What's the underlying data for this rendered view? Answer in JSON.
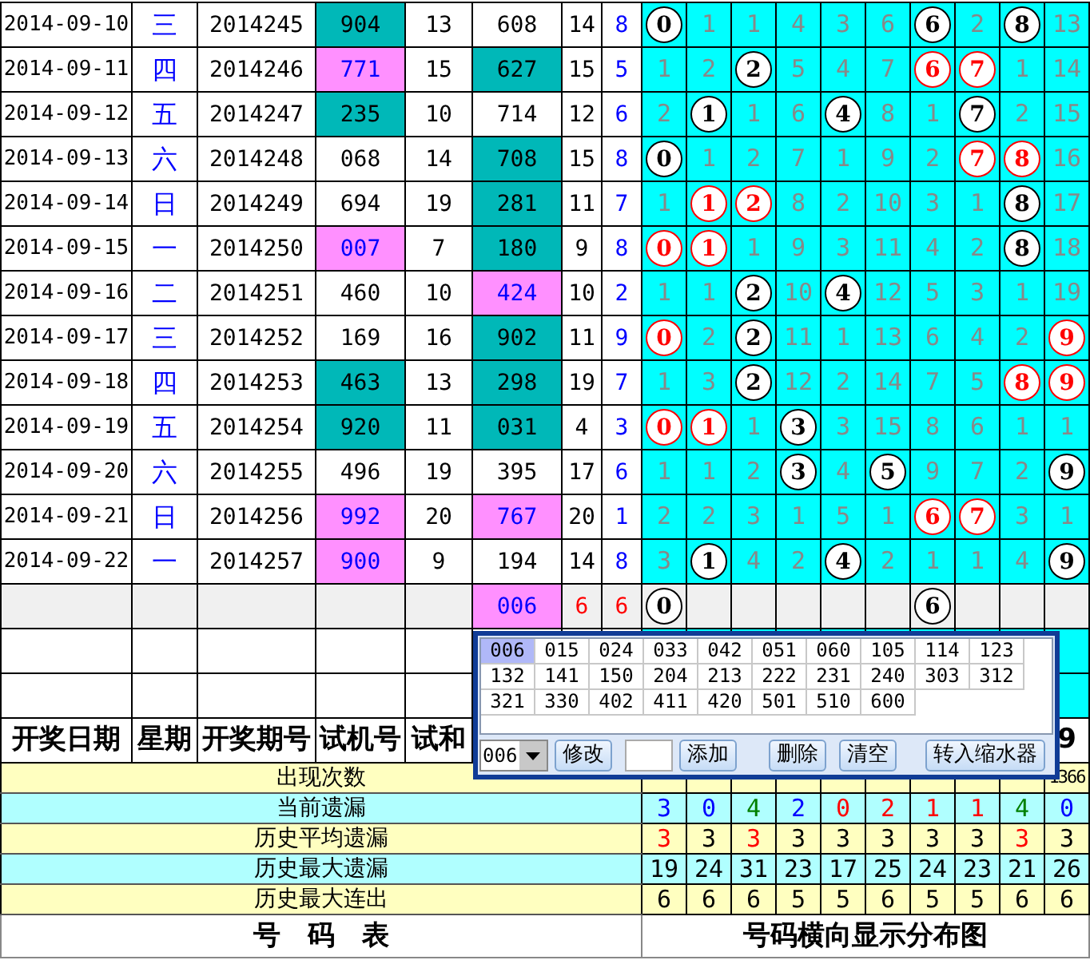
{
  "draw_rows": [
    {
      "date": "2014-09-10",
      "weekday": "三",
      "issue": "2014245",
      "trial": {
        "text": "904",
        "color": "#00b8b8"
      },
      "trial_sum": "13",
      "number": {
        "text": "608"
      },
      "sum": "14",
      "span": "8",
      "digits": [
        {
          "kind": "ball",
          "text": "0",
          "color": "#000000"
        },
        {
          "kind": "miss",
          "text": "1"
        },
        {
          "kind": "miss",
          "text": "1"
        },
        {
          "kind": "miss",
          "text": "4"
        },
        {
          "kind": "miss",
          "text": "3"
        },
        {
          "kind": "miss",
          "text": "6"
        },
        {
          "kind": "ball",
          "text": "6",
          "color": "#000000"
        },
        {
          "kind": "miss",
          "text": "2"
        },
        {
          "kind": "ball",
          "text": "8",
          "color": "#000000"
        },
        {
          "kind": "miss",
          "text": "13"
        }
      ]
    },
    {
      "date": "2014-09-11",
      "weekday": "四",
      "issue": "2014246",
      "trial": {
        "text": "771",
        "color": "#ff90ff"
      },
      "trial_sum": "15",
      "number": {
        "text": "627",
        "color": "#00b8b8"
      },
      "sum": "15",
      "span": "5",
      "digits": [
        {
          "kind": "miss",
          "text": "1"
        },
        {
          "kind": "miss",
          "text": "2"
        },
        {
          "kind": "ball",
          "text": "2",
          "color": "#000000"
        },
        {
          "kind": "miss",
          "text": "5"
        },
        {
          "kind": "miss",
          "text": "4"
        },
        {
          "kind": "miss",
          "text": "7"
        },
        {
          "kind": "ball",
          "text": "6",
          "color": "#ff0000"
        },
        {
          "kind": "ball",
          "text": "7",
          "color": "#ff0000"
        },
        {
          "kind": "miss",
          "text": "1"
        },
        {
          "kind": "miss",
          "text": "14"
        }
      ]
    },
    {
      "date": "2014-09-12",
      "weekday": "五",
      "issue": "2014247",
      "trial": {
        "text": "235",
        "color": "#00b8b8"
      },
      "trial_sum": "10",
      "number": {
        "text": "714"
      },
      "sum": "12",
      "span": "6",
      "digits": [
        {
          "kind": "miss",
          "text": "2"
        },
        {
          "kind": "ball",
          "text": "1",
          "color": "#000000"
        },
        {
          "kind": "miss",
          "text": "1"
        },
        {
          "kind": "miss",
          "text": "6"
        },
        {
          "kind": "ball",
          "text": "4",
          "color": "#000000"
        },
        {
          "kind": "miss",
          "text": "8"
        },
        {
          "kind": "miss",
          "text": "1"
        },
        {
          "kind": "ball",
          "text": "7",
          "color": "#000000"
        },
        {
          "kind": "miss",
          "text": "2"
        },
        {
          "kind": "miss",
          "text": "15"
        }
      ]
    },
    {
      "date": "2014-09-13",
      "weekday": "六",
      "issue": "2014248",
      "trial": {
        "text": "068"
      },
      "trial_sum": "14",
      "number": {
        "text": "708",
        "color": "#00b8b8"
      },
      "sum": "15",
      "span": "8",
      "digits": [
        {
          "kind": "ball",
          "text": "0",
          "color": "#000000"
        },
        {
          "kind": "miss",
          "text": "1"
        },
        {
          "kind": "miss",
          "text": "2"
        },
        {
          "kind": "miss",
          "text": "7"
        },
        {
          "kind": "miss",
          "text": "1"
        },
        {
          "kind": "miss",
          "text": "9"
        },
        {
          "kind": "miss",
          "text": "2"
        },
        {
          "kind": "ball",
          "text": "7",
          "color": "#ff0000"
        },
        {
          "kind": "ball",
          "text": "8",
          "color": "#ff0000"
        },
        {
          "kind": "miss",
          "text": "16"
        }
      ]
    },
    {
      "date": "2014-09-14",
      "weekday": "日",
      "issue": "2014249",
      "trial": {
        "text": "694"
      },
      "trial_sum": "19",
      "number": {
        "text": "281",
        "color": "#00b8b8"
      },
      "sum": "11",
      "span": "7",
      "digits": [
        {
          "kind": "miss",
          "text": "1"
        },
        {
          "kind": "ball",
          "text": "1",
          "color": "#ff0000"
        },
        {
          "kind": "ball",
          "text": "2",
          "color": "#ff0000"
        },
        {
          "kind": "miss",
          "text": "8"
        },
        {
          "kind": "miss",
          "text": "2"
        },
        {
          "kind": "miss",
          "text": "10"
        },
        {
          "kind": "miss",
          "text": "3"
        },
        {
          "kind": "miss",
          "text": "1"
        },
        {
          "kind": "ball",
          "text": "8",
          "color": "#000000"
        },
        {
          "kind": "miss",
          "text": "17"
        }
      ]
    },
    {
      "date": "2014-09-15",
      "weekday": "一",
      "issue": "2014250",
      "trial": {
        "text": "007",
        "color": "#ff90ff"
      },
      "trial_sum": "7",
      "number": {
        "text": "180",
        "color": "#00b8b8"
      },
      "sum": "9",
      "span": "8",
      "digits": [
        {
          "kind": "ball",
          "text": "0",
          "color": "#ff0000"
        },
        {
          "kind": "ball",
          "text": "1",
          "color": "#ff0000"
        },
        {
          "kind": "miss",
          "text": "1"
        },
        {
          "kind": "miss",
          "text": "9"
        },
        {
          "kind": "miss",
          "text": "3"
        },
        {
          "kind": "miss",
          "text": "11"
        },
        {
          "kind": "miss",
          "text": "4"
        },
        {
          "kind": "miss",
          "text": "2"
        },
        {
          "kind": "ball",
          "text": "8",
          "color": "#000000"
        },
        {
          "kind": "miss",
          "text": "18"
        }
      ]
    },
    {
      "date": "2014-09-16",
      "weekday": "二",
      "issue": "2014251",
      "trial": {
        "text": "460"
      },
      "trial_sum": "10",
      "number": {
        "text": "424",
        "color": "#ff90ff"
      },
      "sum": "10",
      "span": "2",
      "digits": [
        {
          "kind": "miss",
          "text": "1"
        },
        {
          "kind": "miss",
          "text": "1"
        },
        {
          "kind": "ball",
          "text": "2",
          "color": "#000000"
        },
        {
          "kind": "miss",
          "text": "10"
        },
        {
          "kind": "ball",
          "text": "4",
          "color": "#000000"
        },
        {
          "kind": "miss",
          "text": "12"
        },
        {
          "kind": "miss",
          "text": "5"
        },
        {
          "kind": "miss",
          "text": "3"
        },
        {
          "kind": "miss",
          "text": "1"
        },
        {
          "kind": "miss",
          "text": "19"
        }
      ]
    },
    {
      "date": "2014-09-17",
      "weekday": "三",
      "issue": "2014252",
      "trial": {
        "text": "169"
      },
      "trial_sum": "16",
      "number": {
        "text": "902",
        "color": "#00b8b8"
      },
      "sum": "11",
      "span": "9",
      "digits": [
        {
          "kind": "ball",
          "text": "0",
          "color": "#ff0000"
        },
        {
          "kind": "miss",
          "text": "2"
        },
        {
          "kind": "ball",
          "text": "2",
          "color": "#000000"
        },
        {
          "kind": "miss",
          "text": "11"
        },
        {
          "kind": "miss",
          "text": "1"
        },
        {
          "kind": "miss",
          "text": "13"
        },
        {
          "kind": "miss",
          "text": "6"
        },
        {
          "kind": "miss",
          "text": "4"
        },
        {
          "kind": "miss",
          "text": "2"
        },
        {
          "kind": "ball",
          "text": "9",
          "color": "#ff0000"
        }
      ]
    },
    {
      "date": "2014-09-18",
      "weekday": "四",
      "issue": "2014253",
      "trial": {
        "text": "463",
        "color": "#00b8b8"
      },
      "trial_sum": "13",
      "number": {
        "text": "298",
        "color": "#00b8b8"
      },
      "sum": "19",
      "span": "7",
      "digits": [
        {
          "kind": "miss",
          "text": "1"
        },
        {
          "kind": "miss",
          "text": "3"
        },
        {
          "kind": "ball",
          "text": "2",
          "color": "#000000"
        },
        {
          "kind": "miss",
          "text": "12"
        },
        {
          "kind": "miss",
          "text": "2"
        },
        {
          "kind": "miss",
          "text": "14"
        },
        {
          "kind": "miss",
          "text": "7"
        },
        {
          "kind": "miss",
          "text": "5"
        },
        {
          "kind": "ball",
          "text": "8",
          "color": "#ff0000"
        },
        {
          "kind": "ball",
          "text": "9",
          "color": "#ff0000"
        }
      ]
    },
    {
      "date": "2014-09-19",
      "weekday": "五",
      "issue": "2014254",
      "trial": {
        "text": "920",
        "color": "#00b8b8"
      },
      "trial_sum": "11",
      "number": {
        "text": "031",
        "color": "#00b8b8"
      },
      "sum": "4",
      "span": "3",
      "digits": [
        {
          "kind": "ball",
          "text": "0",
          "color": "#ff0000"
        },
        {
          "kind": "ball",
          "text": "1",
          "color": "#ff0000"
        },
        {
          "kind": "miss",
          "text": "1"
        },
        {
          "kind": "ball",
          "text": "3",
          "color": "#000000"
        },
        {
          "kind": "miss",
          "text": "3"
        },
        {
          "kind": "miss",
          "text": "15"
        },
        {
          "kind": "miss",
          "text": "8"
        },
        {
          "kind": "miss",
          "text": "6"
        },
        {
          "kind": "miss",
          "text": "1"
        },
        {
          "kind": "miss",
          "text": "1"
        }
      ]
    },
    {
      "date": "2014-09-20",
      "weekday": "六",
      "issue": "2014255",
      "trial": {
        "text": "496"
      },
      "trial_sum": "19",
      "number": {
        "text": "395"
      },
      "sum": "17",
      "span": "6",
      "digits": [
        {
          "kind": "miss",
          "text": "1"
        },
        {
          "kind": "miss",
          "text": "1"
        },
        {
          "kind": "miss",
          "text": "2"
        },
        {
          "kind": "ball",
          "text": "3",
          "color": "#000000"
        },
        {
          "kind": "miss",
          "text": "4"
        },
        {
          "kind": "ball",
          "text": "5",
          "color": "#000000"
        },
        {
          "kind": "miss",
          "text": "9"
        },
        {
          "kind": "miss",
          "text": "7"
        },
        {
          "kind": "miss",
          "text": "2"
        },
        {
          "kind": "ball",
          "text": "9",
          "color": "#000000"
        }
      ]
    },
    {
      "date": "2014-09-21",
      "weekday": "日",
      "issue": "2014256",
      "trial": {
        "text": "992",
        "color": "#ff90ff"
      },
      "trial_sum": "20",
      "number": {
        "text": "767",
        "color": "#ff90ff"
      },
      "sum": "20",
      "span": "1",
      "digits": [
        {
          "kind": "miss",
          "text": "2"
        },
        {
          "kind": "miss",
          "text": "2"
        },
        {
          "kind": "miss",
          "text": "3"
        },
        {
          "kind": "miss",
          "text": "1"
        },
        {
          "kind": "miss",
          "text": "5"
        },
        {
          "kind": "miss",
          "text": "1"
        },
        {
          "kind": "ball",
          "text": "6",
          "color": "#ff0000"
        },
        {
          "kind": "ball",
          "text": "7",
          "color": "#ff0000"
        },
        {
          "kind": "miss",
          "text": "3"
        },
        {
          "kind": "miss",
          "text": "1"
        }
      ]
    },
    {
      "date": "2014-09-22",
      "weekday": "一",
      "issue": "2014257",
      "trial": {
        "text": "900",
        "color": "#ff90ff"
      },
      "trial_sum": "9",
      "number": {
        "text": "194"
      },
      "sum": "14",
      "span": "8",
      "digits": [
        {
          "kind": "miss",
          "text": "3"
        },
        {
          "kind": "ball",
          "text": "1",
          "color": "#000000"
        },
        {
          "kind": "miss",
          "text": "4"
        },
        {
          "kind": "miss",
          "text": "2"
        },
        {
          "kind": "ball",
          "text": "4",
          "color": "#000000"
        },
        {
          "kind": "miss",
          "text": "2"
        },
        {
          "kind": "miss",
          "text": "1"
        },
        {
          "kind": "miss",
          "text": "1"
        },
        {
          "kind": "miss",
          "text": "4"
        },
        {
          "kind": "ball",
          "text": "9",
          "color": "#000000"
        }
      ]
    }
  ],
  "summary_row": {
    "number": {
      "text": "006",
      "color": "#ff90ff"
    },
    "sum": "6",
    "span": "6",
    "digits": [
      {
        "kind": "ball",
        "text": "0",
        "color": "#000000"
      },
      {
        "kind": "blank"
      },
      {
        "kind": "blank"
      },
      {
        "kind": "blank"
      },
      {
        "kind": "blank"
      },
      {
        "kind": "blank"
      },
      {
        "kind": "ball",
        "text": "6",
        "color": "#000000"
      },
      {
        "kind": "blank"
      },
      {
        "kind": "blank"
      },
      {
        "kind": "blank"
      }
    ]
  },
  "header": {
    "columns": [
      "开奖日期",
      "星期",
      "开奖期号",
      "试机号",
      "试和"
    ],
    "last_digit": "9"
  },
  "stats": [
    {
      "label": "出现次数",
      "values": [
        {
          "text": "1366",
          "color": "#000000"
        }
      ]
    },
    {
      "label": "当前遗漏",
      "values": [
        {
          "text": "3",
          "color": "#0000ff"
        },
        {
          "text": "0",
          "color": "#0000ff"
        },
        {
          "text": "4",
          "color": "#008000"
        },
        {
          "text": "2",
          "color": "#0000ff"
        },
        {
          "text": "0",
          "color": "#ff0000"
        },
        {
          "text": "2",
          "color": "#ff0000"
        },
        {
          "text": "1",
          "color": "#ff0000"
        },
        {
          "text": "1",
          "color": "#ff0000"
        },
        {
          "text": "4",
          "color": "#008000"
        },
        {
          "text": "0",
          "color": "#0000ff"
        }
      ]
    },
    {
      "label": "历史平均遗漏",
      "values": [
        {
          "text": "3",
          "color": "#ff0000"
        },
        {
          "text": "3",
          "color": "#000000"
        },
        {
          "text": "3",
          "color": "#ff0000"
        },
        {
          "text": "3",
          "color": "#000000"
        },
        {
          "text": "3",
          "color": "#000000"
        },
        {
          "text": "3",
          "color": "#000000"
        },
        {
          "text": "3",
          "color": "#000000"
        },
        {
          "text": "3",
          "color": "#000000"
        },
        {
          "text": "3",
          "color": "#ff0000"
        },
        {
          "text": "3",
          "color": "#000000"
        }
      ]
    },
    {
      "label": "历史最大遗漏",
      "values": [
        {
          "text": "19",
          "color": "#000000"
        },
        {
          "text": "24",
          "color": "#000000"
        },
        {
          "text": "31",
          "color": "#000000"
        },
        {
          "text": "23",
          "color": "#000000"
        },
        {
          "text": "17",
          "color": "#000000"
        },
        {
          "text": "25",
          "color": "#000000"
        },
        {
          "text": "24",
          "color": "#000000"
        },
        {
          "text": "23",
          "color": "#000000"
        },
        {
          "text": "21",
          "color": "#000000"
        },
        {
          "text": "26",
          "color": "#000000"
        }
      ]
    },
    {
      "label": "历史最大连出",
      "values": [
        {
          "text": "6",
          "color": "#000000"
        },
        {
          "text": "6",
          "color": "#000000"
        },
        {
          "text": "6",
          "color": "#000000"
        },
        {
          "text": "5",
          "color": "#000000"
        },
        {
          "text": "5",
          "color": "#000000"
        },
        {
          "text": "6",
          "color": "#000000"
        },
        {
          "text": "5",
          "color": "#000000"
        },
        {
          "text": "5",
          "color": "#000000"
        },
        {
          "text": "6",
          "color": "#000000"
        },
        {
          "text": "6",
          "color": "#000000"
        }
      ]
    }
  ],
  "footer": {
    "left": "号　码　表",
    "right": "号码横向显示分布图"
  },
  "popup": {
    "items": [
      {
        "text": "006",
        "selected": true
      },
      {
        "text": "015",
        "selected": false
      },
      {
        "text": "024",
        "selected": false
      },
      {
        "text": "033",
        "selected": false
      },
      {
        "text": "042",
        "selected": false
      },
      {
        "text": "051",
        "selected": false
      },
      {
        "text": "060",
        "selected": false
      },
      {
        "text": "105",
        "selected": false
      },
      {
        "text": "114",
        "selected": false
      },
      {
        "text": "123",
        "selected": false
      },
      {
        "text": "132",
        "selected": false
      },
      {
        "text": "141",
        "selected": false
      },
      {
        "text": "150",
        "selected": false
      },
      {
        "text": "204",
        "selected": false
      },
      {
        "text": "213",
        "selected": false
      },
      {
        "text": "222",
        "selected": false
      },
      {
        "text": "231",
        "selected": false
      },
      {
        "text": "240",
        "selected": false
      },
      {
        "text": "303",
        "selected": false
      },
      {
        "text": "312",
        "selected": false
      },
      {
        "text": "321",
        "selected": false
      },
      {
        "text": "330",
        "selected": false
      },
      {
        "text": "402",
        "selected": false
      },
      {
        "text": "411",
        "selected": false
      },
      {
        "text": "420",
        "selected": false
      },
      {
        "text": "501",
        "selected": false
      },
      {
        "text": "510",
        "selected": false
      },
      {
        "text": "600",
        "selected": false
      }
    ],
    "select_value": "006",
    "edit_button": "修改",
    "add_button": "添加",
    "delete_button": "删除",
    "clear_button": "清空",
    "transfer_button": "转入缩水器"
  }
}
